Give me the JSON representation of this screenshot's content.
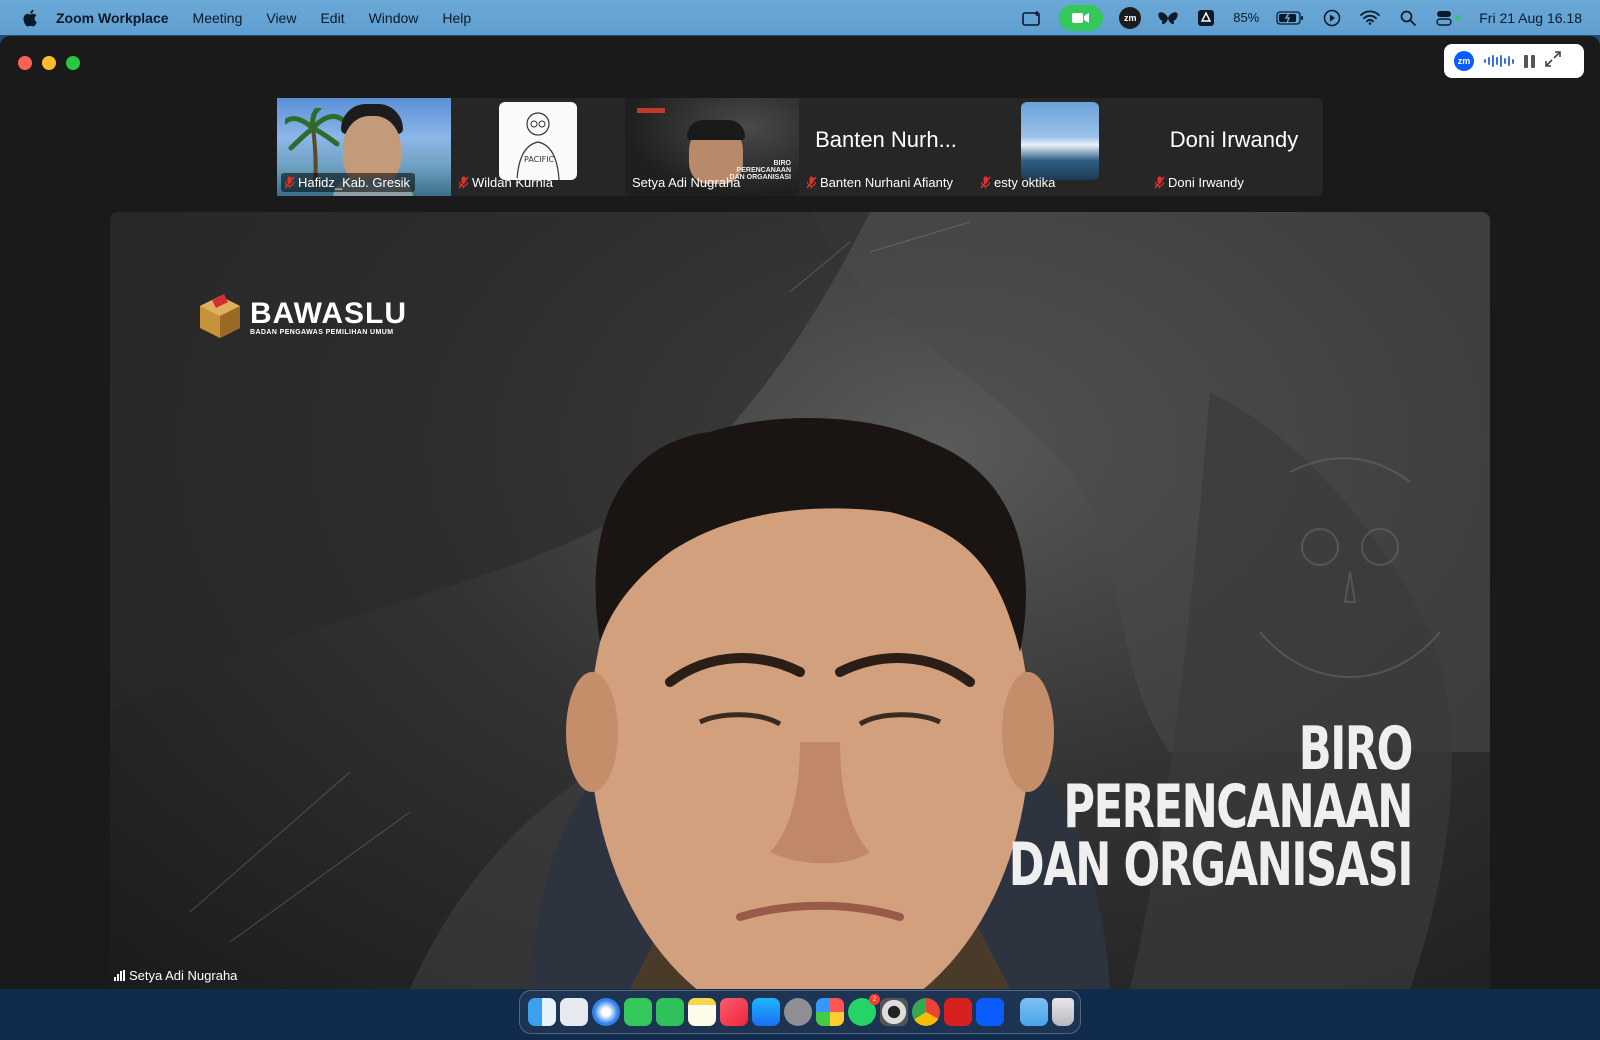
{
  "menubar": {
    "app_name": "Zoom Workplace",
    "items": [
      "Meeting",
      "View",
      "Edit",
      "Window",
      "Help"
    ],
    "battery": "85%",
    "clock": "Fri 21 Aug  16.18"
  },
  "thumbnails": [
    {
      "name": "Hafidz_Kab. Gresik",
      "muted": true,
      "video": "beach-selfie"
    },
    {
      "name": "Wildan Kurnia",
      "muted": true,
      "video": "avatar-sketch"
    },
    {
      "name": "Setya Adi Nugraha",
      "muted": false,
      "active": true,
      "video": "speaker"
    },
    {
      "name": "Banten Nurhani Afianty",
      "display_name": "Banten Nurh...",
      "muted": true,
      "video": "off"
    },
    {
      "name": "esty oktika",
      "muted": true,
      "video": "avatar-sea"
    },
    {
      "name": "Doni Irwandy",
      "display_name": "Doni Irwandy",
      "muted": true,
      "video": "off"
    }
  ],
  "main_video": {
    "speaker_name": "Setya Adi Nugraha",
    "logo_name": "BAWASLU",
    "logo_sub": "BADAN PENGAWAS PEMILIHAN UMUM",
    "banner_lines": [
      "BIRO",
      "PERENCANAAN",
      "DAN ORGANISASI"
    ]
  },
  "mini_thumb_banner_lines": [
    "BIRO",
    "PERENCANAAN",
    "DAN ORGANISASI"
  ],
  "mini_controls": {
    "logo": "zm"
  },
  "colors": {
    "active_border": "#2bd14b",
    "mute_red": "#e0322b",
    "zoom_blue": "#0b5cff"
  },
  "dock": {
    "apps": [
      "finder-icon",
      "launchpad-icon",
      "safari-icon",
      "messages-icon",
      "facetime-icon",
      "notes-icon",
      "music-icon",
      "app-store-icon",
      "system-settings-icon",
      "photos-icon",
      "whatsapp-icon",
      "screenshot-icon",
      "chrome-icon",
      "acrobat-icon",
      "zoom-icon",
      "folder-icon",
      "trash-icon"
    ],
    "whatsapp_badge": "2"
  }
}
